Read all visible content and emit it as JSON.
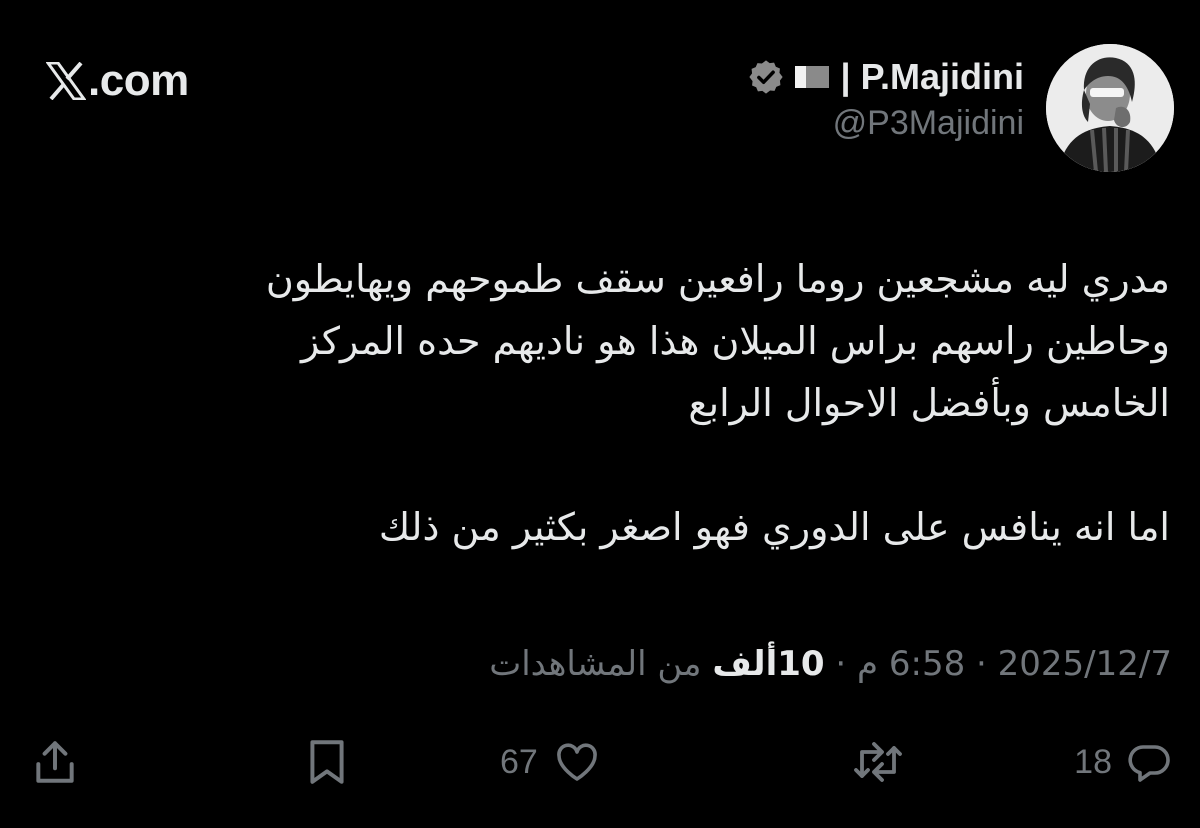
{
  "header": {
    "site_label": ".com",
    "logo_icon": "x-logo-icon"
  },
  "author": {
    "display_name": "| P.Majidini",
    "handle": "@P3Majidini",
    "verified_icon": "verified-badge-icon",
    "flag_icon": "qatar-flag-icon",
    "avatar_icon": "profile-avatar"
  },
  "tweet": {
    "line1": "مدري ليه مشجعين روما رافعين سقف طموحهم ويهايطون",
    "line2": "وحاطين راسهم براس الميلان هذا هو ناديهم حده المركز",
    "line3": "الخامس وبأفضل الاحوال الرابع",
    "line4": "اما انه ينافس على الدوري فهو اصغر بكثير من ذلك"
  },
  "meta": {
    "time": "6:58 م",
    "separator": "·",
    "date": "2025/12/7",
    "views_count": "10ألف",
    "views_label": "من المشاهدات"
  },
  "actions": {
    "reply_count": "18",
    "retweet_count": "",
    "like_count": "67",
    "reply_icon": "reply-icon",
    "retweet_icon": "retweet-icon",
    "like_icon": "heart-icon",
    "bookmark_icon": "bookmark-icon",
    "share_icon": "share-icon"
  },
  "colors": {
    "background": "#000000",
    "text_primary": "#e7e9ea",
    "text_secondary": "#71767b"
  }
}
